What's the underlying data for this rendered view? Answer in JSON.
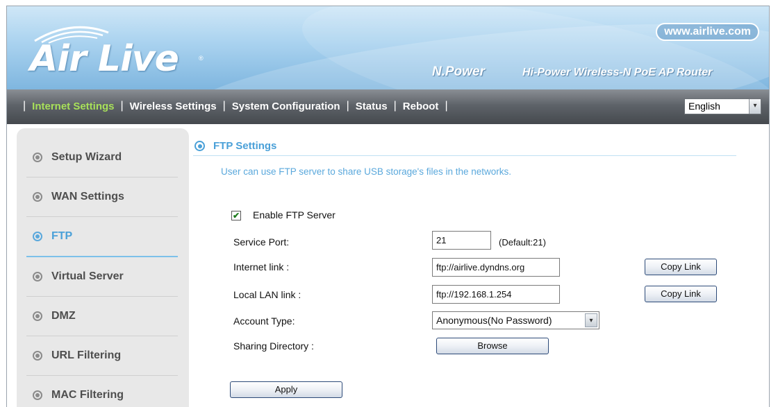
{
  "header": {
    "logo_text": "Air Live",
    "logo_reg": "®",
    "site_url": "www.airlive.com",
    "product_name": "N.Power",
    "product_desc": "Hi-Power Wireless-N PoE AP Router"
  },
  "nav": {
    "items": [
      {
        "label": "Internet Settings",
        "active": true
      },
      {
        "label": "Wireless Settings"
      },
      {
        "label": "System Configuration"
      },
      {
        "label": "Status"
      },
      {
        "label": "Reboot"
      }
    ],
    "separator": "|",
    "language": "English",
    "dropdown_arrow": "▾"
  },
  "sidebar": {
    "items": [
      {
        "label": "Setup Wizard"
      },
      {
        "label": "WAN Settings"
      },
      {
        "label": "FTP",
        "active": true
      },
      {
        "label": "Virtual Server"
      },
      {
        "label": "DMZ"
      },
      {
        "label": "URL Filtering"
      },
      {
        "label": "MAC Filtering"
      }
    ]
  },
  "main": {
    "section_title": "FTP Settings",
    "description": "User can use FTP server to share USB storage's files in the networks.",
    "enable_label": "Enable FTP Server",
    "enable_checked": true,
    "checkmark": "✔",
    "service_port": {
      "label": "Service Port:",
      "value": "21",
      "hint": "(Default:21)"
    },
    "internet_link": {
      "label": "Internet link :",
      "value": "ftp://airlive.dyndns.org",
      "button": "Copy Link"
    },
    "local_link": {
      "label": "Local LAN link :",
      "value": "ftp://192.168.1.254",
      "button": "Copy Link"
    },
    "account_type": {
      "label": "Account Type:",
      "value": "Anonymous(No Password)"
    },
    "sharing_dir": {
      "label": "Sharing Directory :",
      "button": "Browse"
    },
    "apply_label": "Apply"
  },
  "colors": {
    "accent": "#4aa0d8",
    "nav_active": "#a8e05a",
    "nav_bg": "#5e6369",
    "sidebar_bg": "#e8e8e8"
  }
}
